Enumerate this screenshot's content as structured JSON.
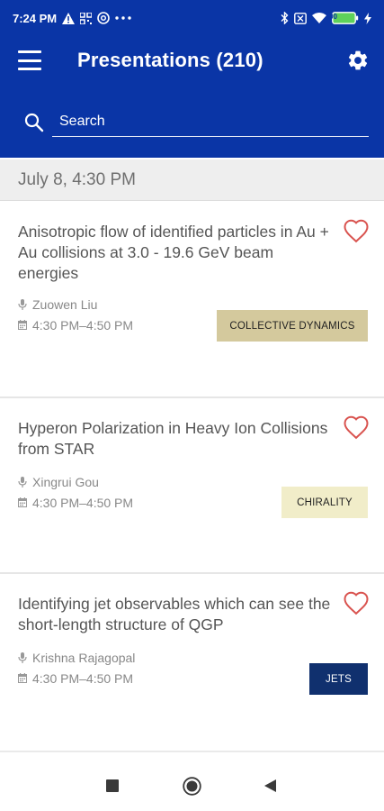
{
  "status_bar": {
    "time": "7:24 PM",
    "battery": "100"
  },
  "header": {
    "title": "Presentations (210)",
    "search_placeholder": "Search"
  },
  "section": {
    "date": "July 8, 4:30 PM"
  },
  "presentations": [
    {
      "title": "Anisotropic flow of identified particles in Au + Au collisions at 3.0 - 19.6 GeV beam energies",
      "speaker": "Zuowen Liu",
      "time": "4:30 PM–4:50 PM",
      "tag": "COLLECTIVE DYNAMICS",
      "tag_bg": "#d4c99d",
      "tag_fg": "#222222"
    },
    {
      "title": "Hyperon Polarization in Heavy Ion Collisions from STAR",
      "speaker": "Xingrui Gou",
      "time": "4:30 PM–4:50 PM",
      "tag": "CHIRALITY",
      "tag_bg": "#f1edc9",
      "tag_fg": "#222222"
    },
    {
      "title": "Identifying jet observables which can see the short-length structure of QGP",
      "speaker": "Krishna Rajagopal",
      "time": "4:30 PM–4:50 PM",
      "tag": "JETS",
      "tag_bg": "#10306e",
      "tag_fg": "#ffffff"
    }
  ],
  "colors": {
    "primary": "#0a35a6",
    "heart": "#d9534f"
  }
}
